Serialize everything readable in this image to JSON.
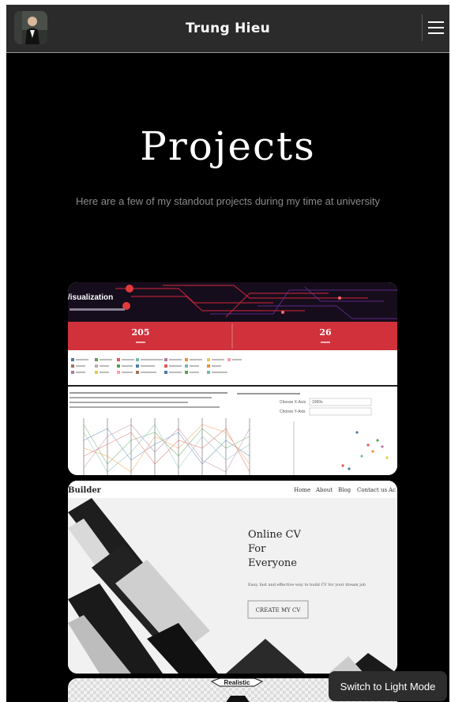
{
  "navbar": {
    "brand": "Trung Hieu"
  },
  "hero": {
    "title": "Projects",
    "subtitle": "Here are a few of my standout projects during my time at university"
  },
  "projects": [
    {
      "heading": "/isualization",
      "stat_left": "205",
      "stat_right": "26",
      "filter_label_1": "Choose X-Axis",
      "filter_value_1": "1990s",
      "filter_label_2": "Choose Y-Axis"
    },
    {
      "brand": "Builder",
      "nav": [
        "Home",
        "About",
        "Blog",
        "Contact us",
        "Ac"
      ],
      "headline": [
        "Online CV",
        "For",
        "Everyone"
      ],
      "description": "Easy, fast and effective way to build CV for your dream job",
      "cta": "CREATE MY CV"
    },
    {
      "tag": "Realistic"
    }
  ],
  "theme_toggle": "Switch to Light Mode",
  "colors": {
    "navbar_bg": "#2b2b2b",
    "page_bg": "#000000",
    "accent_red": "#d0313b",
    "hero_text": "#ffffff",
    "subtitle_text": "#8a8a8a"
  }
}
